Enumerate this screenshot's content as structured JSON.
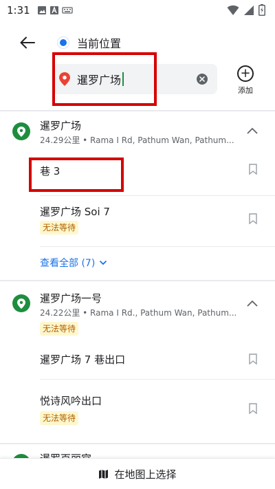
{
  "status_bar": {
    "time": "1:31",
    "icons": [
      "image-icon",
      "a-icon",
      "keyboard-icon",
      "wifi-icon",
      "signal-icon",
      "battery-charging-icon"
    ]
  },
  "directions": {
    "origin_label": "当前位置",
    "search_value": "暹罗广场",
    "add_label": "添加"
  },
  "results": [
    {
      "title": "暹罗广场",
      "subtitle": "24.29公里 • Rama I Rd, Pathum Wan, Pathum...",
      "children": [
        {
          "title": "巷 3",
          "badge": null
        },
        {
          "title": "暹罗广场 Soi 7",
          "badge": "无法等待"
        }
      ],
      "see_all": "查看全部 (7)"
    },
    {
      "title": "暹罗广场一号",
      "subtitle": "24.22公里 • Rama I Rd., Pathum Wan, Pathum...",
      "badge": "无法等待",
      "children": [
        {
          "title": "暹罗广场 7 巷出口",
          "badge": null
        },
        {
          "title": "悦诗风吟出口",
          "badge": "无法等待"
        }
      ]
    },
    {
      "title": "暹罗百丽宫"
    }
  ],
  "bottom": {
    "choose_on_map": "在地图上选择"
  },
  "colors": {
    "accent_blue": "#1a73e8",
    "place_green": "#1e8e3e",
    "badge_bg": "#fef7cd",
    "badge_text": "#b06000",
    "highlight_red": "#d50000"
  }
}
